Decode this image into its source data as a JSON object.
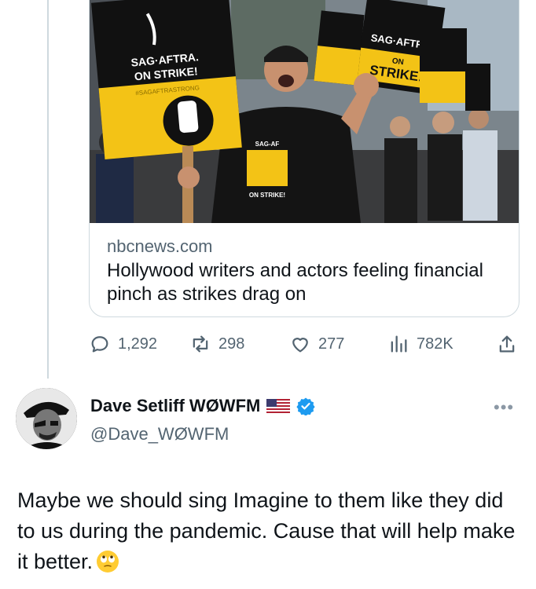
{
  "link_card": {
    "domain": "nbcnews.com",
    "title": "Hollywood writers and actors feeling financial pinch as strikes drag on",
    "image": {
      "sign_main_line1": "SAG·AFTRA.",
      "sign_main_line2": "ON STRIKE!",
      "sign_main_hashtag": "#SAGAFTRASTRONG",
      "sign_right_line1": "SAG·AFTRA",
      "sign_right_line2": "ON",
      "sign_right_line3": "STRIKE!",
      "shirt_top": "SAG-AF",
      "shirt_bottom": "ON STRIKE!"
    }
  },
  "actions": {
    "replies": "1,292",
    "reposts": "298",
    "likes": "277",
    "views": "782K"
  },
  "post": {
    "display_name": "Dave Setliff WØWFM",
    "handle": "@Dave_WØWFM",
    "text": "Maybe we should sing Imagine to them like they did to us during the pandemic. Cause that will help make it better.",
    "more_icon": "•••",
    "accent_color": "#1d9bf0"
  }
}
